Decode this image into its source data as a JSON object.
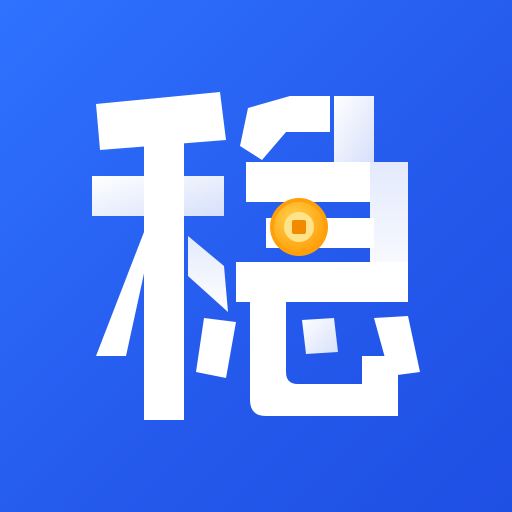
{
  "icon": {
    "glyph": "稳",
    "glyph_is_logo_artwork": true,
    "icon_name": "app-icon-wen-coin",
    "colors": {
      "background": "#2a63f4",
      "glyph": "#ffffff",
      "glyph_shade": "#d9e3fb",
      "coin_outer": "#ffb31a",
      "coin_inner": "#ffe38a",
      "coin_hole": "#f28a00"
    }
  }
}
